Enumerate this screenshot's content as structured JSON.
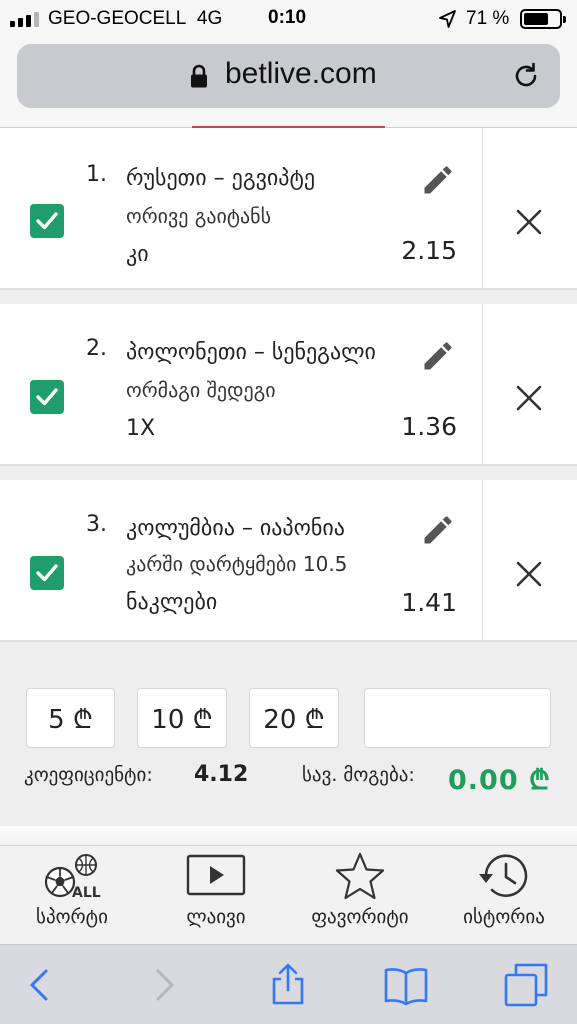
{
  "status_bar": {
    "carrier": "GEO-GEOCELL",
    "network": "4G",
    "time": "0:10",
    "battery_percent": "71 %",
    "battery_level": 0.71,
    "signal_bars_filled": 3
  },
  "browser": {
    "url": "betlive.com"
  },
  "bets": [
    {
      "number": "1.",
      "match": "რუსეთი – ეგვიპტე",
      "market": "ორივე გაიტანს",
      "selection": "კი",
      "odds": "2.15",
      "checked": true
    },
    {
      "number": "2.",
      "match": "პოლონეთი – სენეგალი",
      "market": "ორმაგი შედეგი",
      "selection": "1X",
      "odds": "1.36",
      "checked": true
    },
    {
      "number": "3.",
      "match": "კოლუმბია – იაპონია",
      "market": "კარში დარტყმები 10.5",
      "selection": "ნაკლები",
      "odds": "1.41",
      "checked": true
    }
  ],
  "stake": {
    "quick_amounts": [
      "5 ₾",
      "10 ₾",
      "20 ₾"
    ],
    "input_value": "",
    "coefficient_label": "კოეფიციენტი:",
    "coefficient_value": "4.12",
    "win_label": "სავ. მოგება:",
    "win_value": "0.00 ₾"
  },
  "bottom_nav": [
    {
      "label": "სპორტი",
      "icon": "sports-all-icon",
      "icon_text": "ALL"
    },
    {
      "label": "ლაივი",
      "icon": "live-play-icon"
    },
    {
      "label": "ფავორიტი",
      "icon": "star-icon"
    },
    {
      "label": "ისტორია",
      "icon": "history-icon"
    }
  ],
  "colors": {
    "accent_green": "#1f9d6c",
    "win_green": "#1f9d5a",
    "ios_blue": "#3478f6",
    "progress_red": "#e03a48"
  }
}
